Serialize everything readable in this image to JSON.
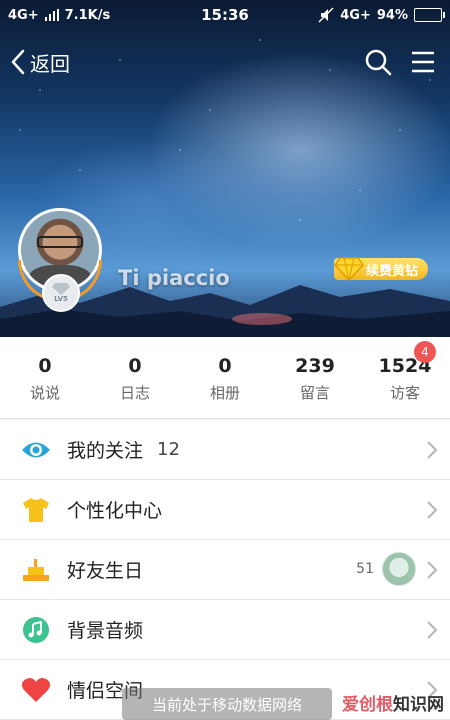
{
  "status_bar": {
    "network": "4G+",
    "speed": "7.1K/s",
    "time": "15:36",
    "right_network": "4G+",
    "battery": "94%",
    "battery_level": 0.94
  },
  "nav": {
    "back_label": "返回"
  },
  "profile": {
    "name": "Ti piaccio",
    "level_text": "LV5",
    "vip_label": "续费黄钻"
  },
  "stats": [
    {
      "value": "0",
      "label": "说说"
    },
    {
      "value": "0",
      "label": "日志"
    },
    {
      "value": "0",
      "label": "相册"
    },
    {
      "value": "239",
      "label": "留言"
    },
    {
      "value": "1524",
      "label": "访客",
      "badge": "4"
    }
  ],
  "menu": [
    {
      "label": "我的关注",
      "count": "12",
      "icon": "eye-icon"
    },
    {
      "label": "个性化中心",
      "icon": "shirt-icon"
    },
    {
      "label": "好友生日",
      "side_count": "51",
      "icon": "cake-icon"
    },
    {
      "label": "背景音频",
      "icon": "music-icon"
    },
    {
      "label": "情侣空间",
      "icon": "heart-icon"
    }
  ],
  "toast": "当前处于移动数据网络",
  "watermark": {
    "accent": "爱创根",
    "rest": "知识网"
  },
  "colors": {
    "accent_badge": "#f05555",
    "vip_gold": "#f2b71c",
    "eye_blue": "#2aa3d9",
    "shirt_yellow": "#f6c21a",
    "music_green": "#3cc38f",
    "heart_red": "#ee4444"
  }
}
